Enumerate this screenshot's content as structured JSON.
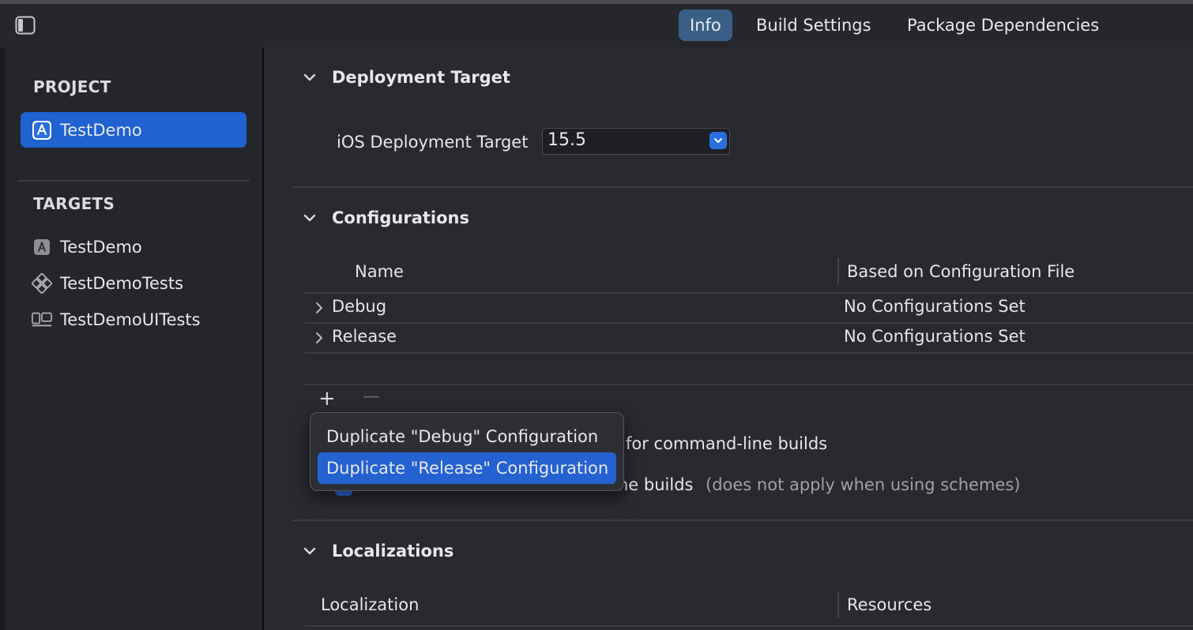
{
  "toolbar": {
    "tabs": [
      {
        "label": "Info",
        "active": true
      },
      {
        "label": "Build Settings",
        "active": false
      },
      {
        "label": "Package Dependencies",
        "active": false
      }
    ]
  },
  "sidebar": {
    "project_header": "PROJECT",
    "project_item": {
      "label": "TestDemo",
      "icon": "app-project-icon"
    },
    "targets_header": "TARGETS",
    "targets": [
      {
        "label": "TestDemo",
        "icon": "app-target-icon"
      },
      {
        "label": "TestDemoTests",
        "icon": "unit-test-icon"
      },
      {
        "label": "TestDemoUITests",
        "icon": "ui-test-icon"
      }
    ]
  },
  "deployment": {
    "title": "Deployment Target",
    "ios_label": "iOS Deployment Target",
    "ios_value": "15.5"
  },
  "configurations": {
    "title": "Configurations",
    "columns": {
      "name": "Name",
      "based_on": "Based on Configuration File"
    },
    "rows": [
      {
        "name": "Debug",
        "based_on": "No Configurations Set"
      },
      {
        "name": "Release",
        "based_on": "No Configurations Set"
      }
    ],
    "add_symbol": "+",
    "remove_symbol": "—",
    "cmdline_text": "for command-line builds",
    "partial_text": "ne builds",
    "schemes_note": "(does not apply when using schemes)"
  },
  "menu": {
    "items": [
      {
        "label": "Duplicate \"Debug\" Configuration",
        "highlighted": false
      },
      {
        "label": "Duplicate \"Release\" Configuration",
        "highlighted": true
      }
    ]
  },
  "localizations": {
    "title": "Localizations",
    "columns": {
      "localization": "Localization",
      "resources": "Resources"
    }
  },
  "colors": {
    "accent": "#1f62d0",
    "tab_active": "#3a5f86",
    "background": "#292a2f"
  }
}
